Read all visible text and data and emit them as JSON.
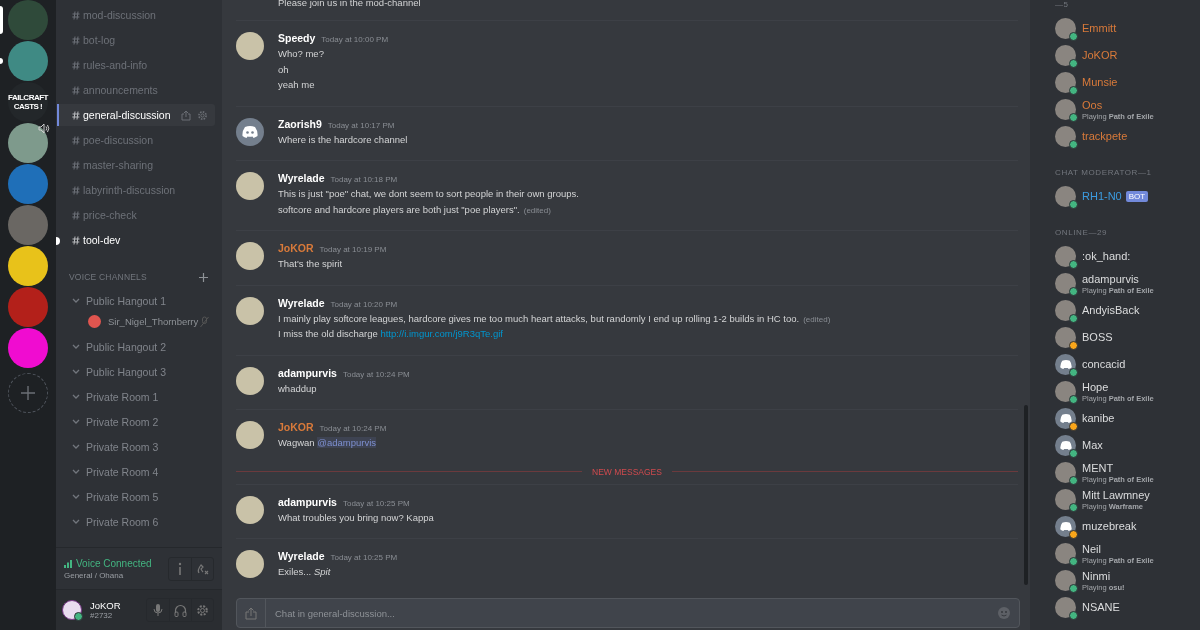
{
  "servers": [
    {
      "kind": "image",
      "color": "#2f4a3a",
      "selected": true,
      "unread": false,
      "speaking": false
    },
    {
      "kind": "image",
      "color": "#3f8a84",
      "selected": false,
      "unread": true,
      "speaking": false
    },
    {
      "kind": "text",
      "label": "FAILCRAFT CASTS !",
      "selected": false,
      "unread": false,
      "speaking": false
    },
    {
      "kind": "image",
      "color": "#7e9a8c",
      "selected": false,
      "unread": false,
      "speaking": true
    },
    {
      "kind": "image",
      "color": "#1f6fb8",
      "selected": false,
      "unread": false,
      "speaking": false
    },
    {
      "kind": "image",
      "color": "#6a6763",
      "selected": false,
      "unread": false,
      "speaking": false
    },
    {
      "kind": "image",
      "color": "#e8c21a",
      "selected": false,
      "unread": false,
      "speaking": false
    },
    {
      "kind": "image",
      "color": "#b3201a",
      "selected": false,
      "unread": false,
      "speaking": false
    },
    {
      "kind": "image",
      "color": "#f00cd0",
      "selected": false,
      "unread": false,
      "speaking": false
    },
    {
      "kind": "add"
    }
  ],
  "text_channels": [
    {
      "name": "mod-discussion",
      "selected": false,
      "unread": false
    },
    {
      "name": "bot-log",
      "selected": false,
      "unread": false
    },
    {
      "name": "rules-and-info",
      "selected": false,
      "unread": false
    },
    {
      "name": "announcements",
      "selected": false,
      "unread": false
    },
    {
      "name": "general-discussion",
      "selected": true,
      "unread": false
    },
    {
      "name": "poe-discussion",
      "selected": false,
      "unread": false
    },
    {
      "name": "master-sharing",
      "selected": false,
      "unread": false
    },
    {
      "name": "labyrinth-discussion",
      "selected": false,
      "unread": false
    },
    {
      "name": "price-check",
      "selected": false,
      "unread": false
    },
    {
      "name": "tool-dev",
      "selected": false,
      "unread": true
    }
  ],
  "voice_header": "VOICE CHANNELS",
  "voice_channels": [
    {
      "name": "Public Hangout 1",
      "children": [
        {
          "name": "Sir_Nigel_Thornberry",
          "muted": true
        }
      ]
    },
    {
      "name": "Public Hangout 2"
    },
    {
      "name": "Public Hangout 3"
    },
    {
      "name": "Private Room 1"
    },
    {
      "name": "Private Room 2"
    },
    {
      "name": "Private Room 3"
    },
    {
      "name": "Private Room 4"
    },
    {
      "name": "Private Room 5"
    },
    {
      "name": "Private Room 6"
    }
  ],
  "voice_status": {
    "title": "Voice Connected",
    "detail": "General / Ohana"
  },
  "user": {
    "name": "JoKOR",
    "tag": "#2732",
    "idle": false
  },
  "messages": [
    {
      "kind": "tail",
      "lines": [
        {
          "text": "Please join us in the mod-channel"
        }
      ]
    },
    {
      "kind": "message",
      "author": "Speedy",
      "color": "#ffffff",
      "default_avatar": false,
      "time": "Today at 10:00 PM",
      "lines": [
        {
          "text": "Who? me?"
        },
        {
          "text": "oh"
        },
        {
          "text": "yeah me"
        }
      ]
    },
    {
      "kind": "message",
      "author": "Zaorish9",
      "color": "#ffffff",
      "default_avatar": true,
      "time": "Today at 10:17 PM",
      "lines": [
        {
          "text": "Where is the hardcore channel"
        }
      ]
    },
    {
      "kind": "message",
      "author": "Wyrelade",
      "color": "#ffffff",
      "default_avatar": false,
      "time": "Today at 10:18 PM",
      "lines": [
        {
          "text": "This is just \"poe\" chat, we dont seem to sort people in their own groups."
        },
        {
          "text": "softcore and hardcore players are both just \"poe players\".",
          "edited": "(edited)"
        }
      ]
    },
    {
      "kind": "message",
      "author": "JoKOR",
      "color": "#d97a3a",
      "default_avatar": false,
      "time": "Today at 10:19 PM",
      "lines": [
        {
          "text": "That's the spirit"
        }
      ]
    },
    {
      "kind": "message",
      "author": "Wyrelade",
      "color": "#ffffff",
      "default_avatar": false,
      "time": "Today at 10:20 PM",
      "lines": [
        {
          "text": "I mainly play softcore leagues, hardcore gives me too much heart attacks, but randomly I end up rolling 1-2 builds in HC too.",
          "edited": "(edited)"
        },
        {
          "text": "I miss the old discharge ",
          "link": "http://i.imgur.com/j9R3qTe.gif"
        }
      ]
    },
    {
      "kind": "message",
      "author": "adampurvis",
      "color": "#ffffff",
      "default_avatar": false,
      "time": "Today at 10:24 PM",
      "lines": [
        {
          "text": "whaddup"
        }
      ]
    },
    {
      "kind": "message",
      "author": "JoKOR",
      "color": "#d97a3a",
      "default_avatar": false,
      "time": "Today at 10:24 PM",
      "lines": [
        {
          "text": "Wagwan ",
          "mention": "@adampurvis"
        }
      ]
    },
    {
      "kind": "divider",
      "label": "NEW MESSAGES"
    },
    {
      "kind": "message",
      "author": "adampurvis",
      "color": "#ffffff",
      "default_avatar": false,
      "time": "Today at 10:25 PM",
      "lines": [
        {
          "text": "What troubles you bring now? Kappa"
        }
      ]
    },
    {
      "kind": "message",
      "author": "Wyrelade",
      "color": "#ffffff",
      "default_avatar": false,
      "time": "Today at 10:25 PM",
      "lines": [
        {
          "text": "Exiles... *Spit*"
        }
      ]
    }
  ],
  "composer": {
    "placeholder": "Chat in general-discussion..."
  },
  "member_groups": [
    {
      "header": "—5",
      "members": [
        {
          "name": "Emmitt",
          "color": "#d97a3a",
          "default_avatar": false,
          "idle": false
        },
        {
          "name": "JoKOR",
          "color": "#d97a3a",
          "default_avatar": false,
          "idle": false
        },
        {
          "name": "Munsie",
          "color": "#d97a3a",
          "default_avatar": false,
          "idle": false
        },
        {
          "name": "Oos",
          "color": "#d97a3a",
          "default_avatar": false,
          "idle": false,
          "activity": "Playing **Path of Exile**"
        },
        {
          "name": "trackpete",
          "color": "#d97a3a",
          "default_avatar": false,
          "idle": false
        }
      ]
    },
    {
      "header": "CHAT MODERATOR—1",
      "members": [
        {
          "name": "RH1-N0",
          "color": "#3b9be0",
          "default_avatar": false,
          "idle": false,
          "badge": "BOT"
        }
      ]
    },
    {
      "header": "ONLINE—29",
      "members": [
        {
          "name": ":ok_hand:",
          "color": "#dcddde",
          "default_avatar": false,
          "idle": false
        },
        {
          "name": "adampurvis",
          "color": "#dcddde",
          "default_avatar": false,
          "idle": false,
          "activity": "Playing **Path of Exile**"
        },
        {
          "name": "AndyisBack",
          "color": "#dcddde",
          "default_avatar": false,
          "idle": false
        },
        {
          "name": "BOSS",
          "color": "#dcddde",
          "default_avatar": false,
          "idle": true
        },
        {
          "name": "concacid",
          "color": "#dcddde",
          "default_avatar": true,
          "idle": false
        },
        {
          "name": "Hope",
          "color": "#dcddde",
          "default_avatar": false,
          "idle": false,
          "activity": "Playing **Path of Exile**"
        },
        {
          "name": "kanibe",
          "color": "#dcddde",
          "default_avatar": true,
          "idle": true
        },
        {
          "name": "Max",
          "color": "#dcddde",
          "default_avatar": true,
          "idle": false
        },
        {
          "name": "MENT",
          "color": "#dcddde",
          "default_avatar": false,
          "idle": false,
          "activity": "Playing **Path of Exile**"
        },
        {
          "name": "Mitt Lawmney",
          "color": "#dcddde",
          "default_avatar": false,
          "idle": false,
          "activity": "Playing **Warframe**"
        },
        {
          "name": "muzebreak",
          "color": "#dcddde",
          "default_avatar": true,
          "idle": true
        },
        {
          "name": "Neil",
          "color": "#dcddde",
          "default_avatar": false,
          "idle": false,
          "activity": "Playing **Path of Exile**"
        },
        {
          "name": "Ninmi",
          "color": "#dcddde",
          "default_avatar": false,
          "idle": false,
          "activity": "Playing **osu!**"
        },
        {
          "name": "NSANE",
          "color": "#dcddde",
          "default_avatar": false,
          "idle": false
        }
      ]
    }
  ]
}
